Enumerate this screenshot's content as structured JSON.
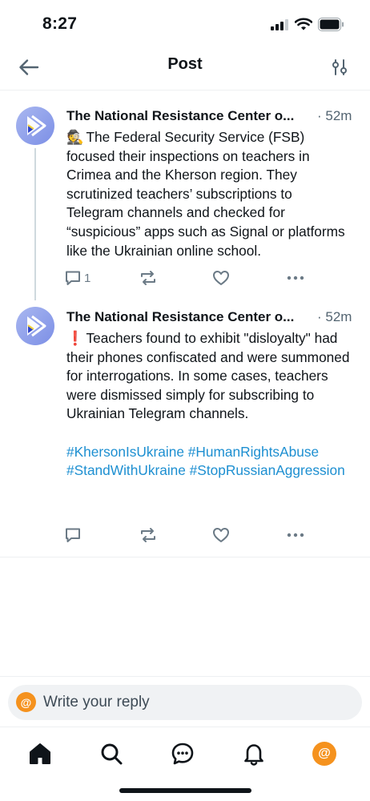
{
  "status_bar": {
    "time": "8:27",
    "signal_icon": "cellular-signal-icon",
    "wifi_icon": "wifi-icon",
    "battery_icon": "battery-icon"
  },
  "header": {
    "title": "Post",
    "back_icon": "arrow-left-icon",
    "filter_icon": "sliders-icon"
  },
  "posts": [
    {
      "author": "The National Resistance Center o...",
      "time": "· 52m",
      "lead_emoji": "🕵",
      "text": "The Federal Security Service (FSB) focused their inspections on teachers in Crimea and the Kherson region. They scrutinized teachers’ subscriptions to Telegram channels and checked for “suspicious” apps such as Signal or platforms like the Ukrainian online school.",
      "reply_count": "1",
      "hashtags": ""
    },
    {
      "author": "The National Resistance Center o...",
      "time": "· 52m",
      "lead_emoji": "❗",
      "text": "Teachers found to exhibit \"disloyalty\" had their phones confiscated and were summoned for interrogations. In some cases, teachers were dismissed simply for subscribing to Ukrainian Telegram channels.",
      "reply_count": "",
      "hashtags": "#KhersonIsUkraine #HumanRightsAbuse #StandWithUkraine #StopRussianAggression"
    }
  ],
  "reply": {
    "placeholder": "Write your reply",
    "avatar_glyph": "@"
  },
  "nav": {
    "items": [
      "home-icon",
      "search-icon",
      "chat-icon",
      "bell-icon",
      "profile-avatar"
    ],
    "avatar_glyph": "@"
  },
  "colors": {
    "accent": "#1d8fd1",
    "avatar_orange": "#f5921e",
    "muted": "#536471"
  }
}
